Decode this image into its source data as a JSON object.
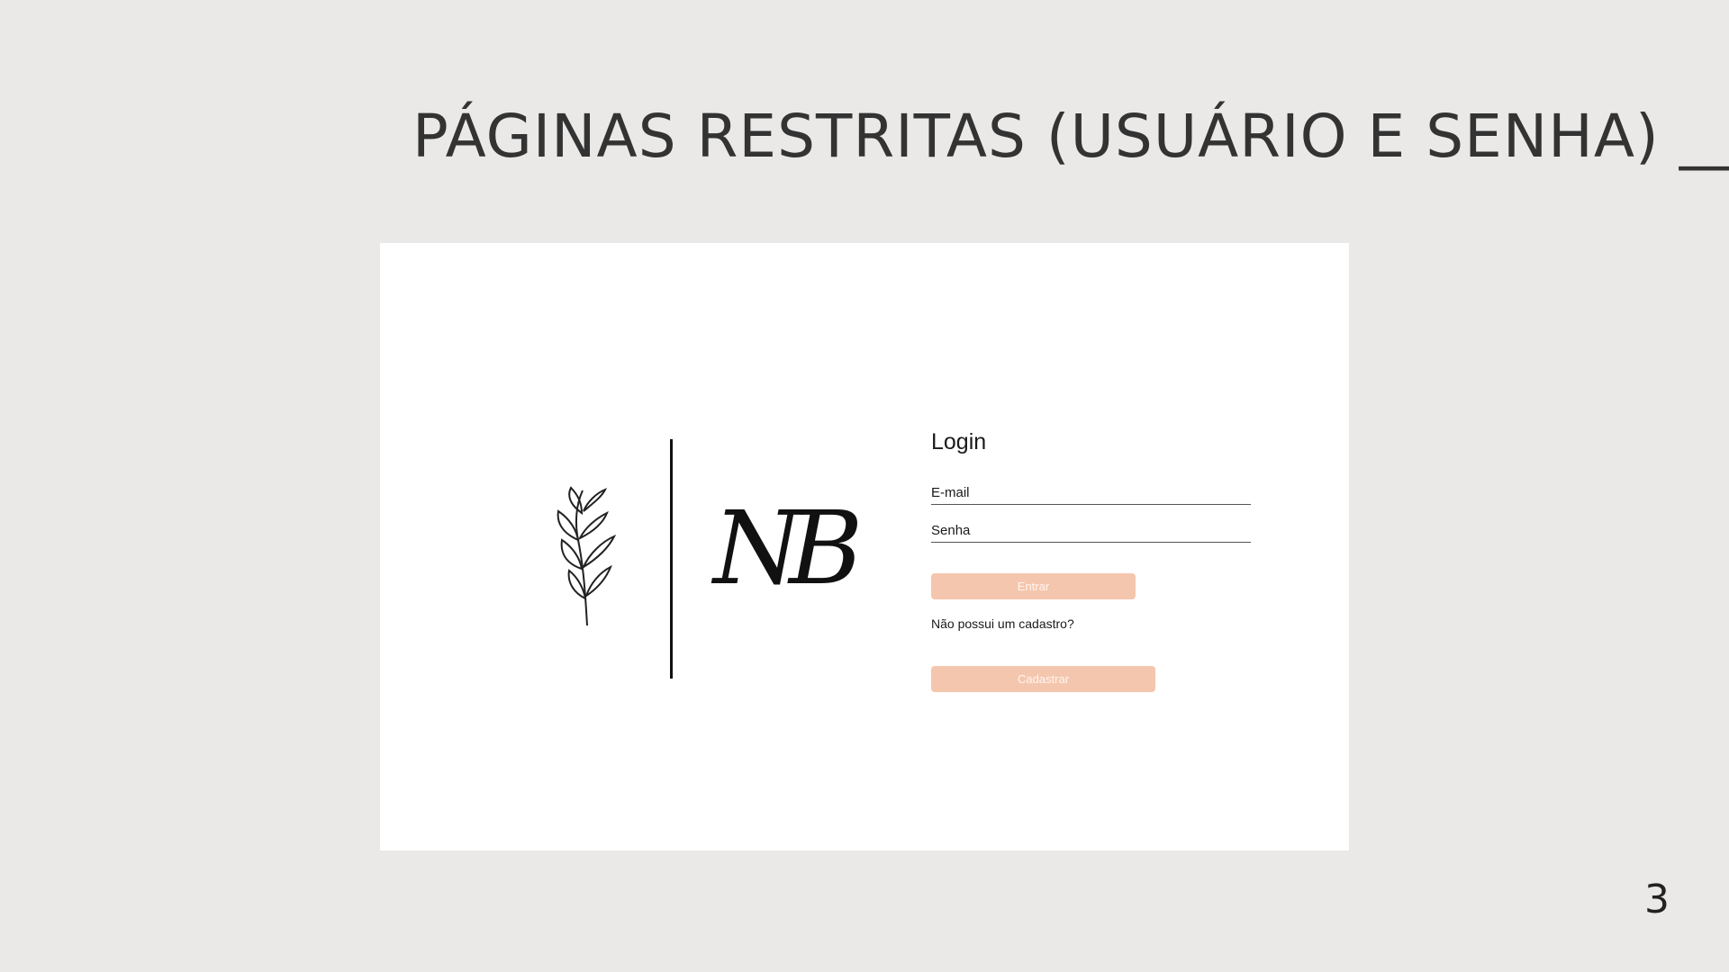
{
  "slide": {
    "title": "PÁGINAS RESTRITAS (USUÁRIO E SENHA) __",
    "page_number": "3"
  },
  "logo": {
    "monogram": "NB",
    "icon": "leaf-branch-icon"
  },
  "login": {
    "title": "Login",
    "email_placeholder": "E-mail",
    "password_placeholder": "Senha",
    "enter_label": "Entrar",
    "register_prompt": "Não possui um cadastro?",
    "register_label": "Cadastrar"
  },
  "colors": {
    "background": "#eae9e7",
    "button": "#f5c6ae",
    "text": "#333333"
  }
}
